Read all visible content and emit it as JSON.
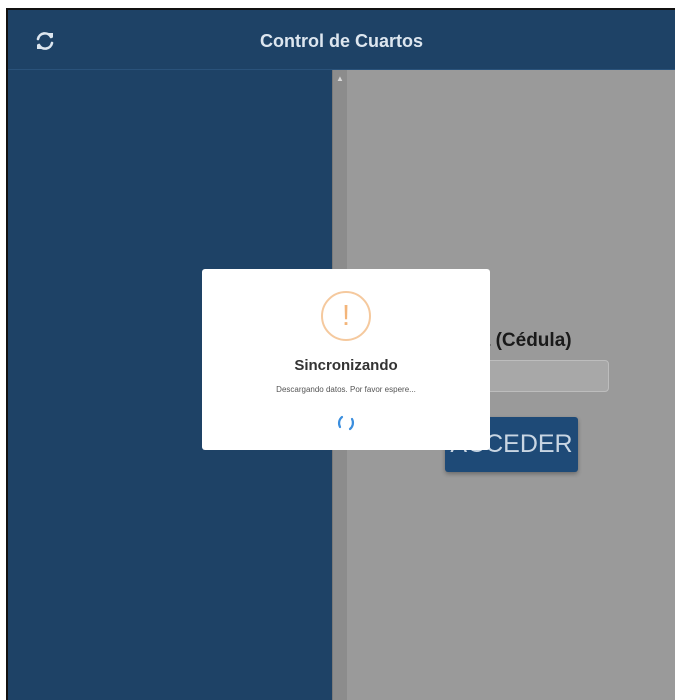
{
  "header": {
    "title": "Control de Cuartos",
    "sync_icon": "sync-icon"
  },
  "login": {
    "password_label": "seña (Cédula)",
    "password_value": "",
    "access_button_label": "ACCEDER"
  },
  "dialog": {
    "icon": "exclamation-icon",
    "title": "Sincronizando",
    "message": "Descargando datos. Por favor espere...",
    "spinner_icon": "spinner-icon"
  },
  "colors": {
    "header_bg": "#1e4266",
    "overlay": "#9a9a9a",
    "warning": "#f3b57a",
    "spinner": "#3b8ede",
    "button_bg": "#1e4a77"
  }
}
